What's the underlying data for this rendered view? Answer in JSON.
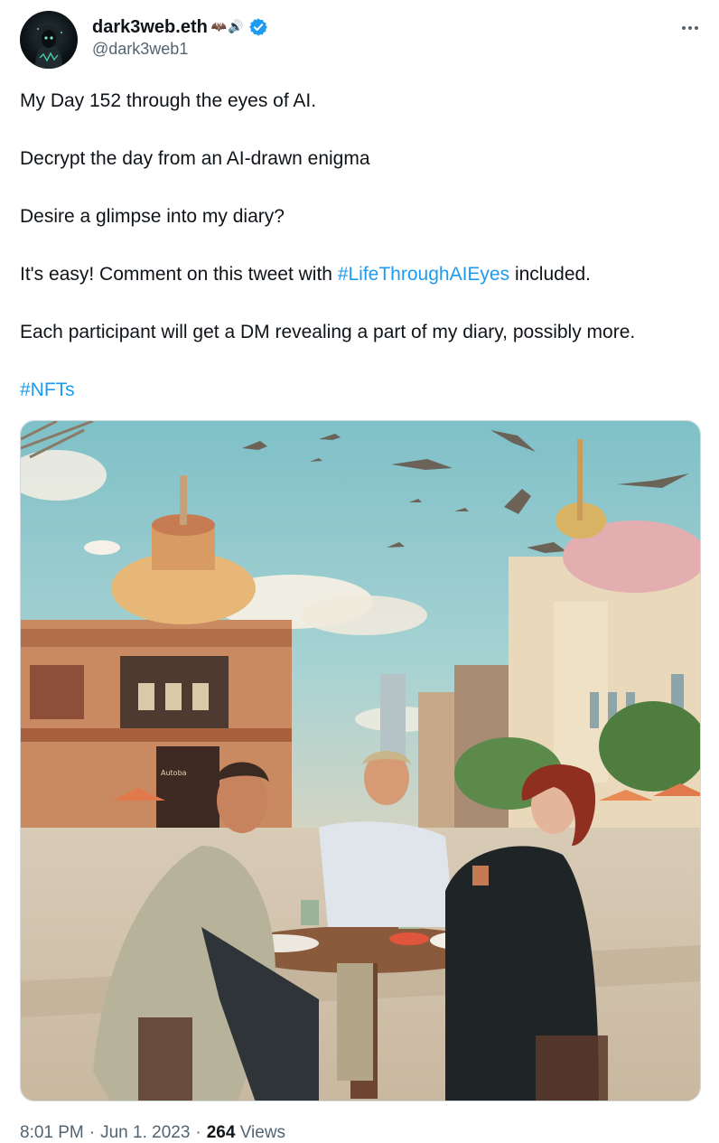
{
  "author": {
    "display_name": "dark3web.eth",
    "name_emoji": "🦇🔊",
    "handle": "@dark3web1",
    "verified_color": "#1d9bf0",
    "avatar_icon": "hooded-figure-avatar"
  },
  "tweet": {
    "line1": "My Day 152 through the eyes of AI.",
    "line2": "Decrypt the day from an AI-drawn enigma",
    "line3": "Desire a glimpse into my diary?",
    "line4_before": "It's easy! Comment on this tweet with ",
    "line4_hashtag": "#LifeThroughAIEyes",
    "line4_after": " included.",
    "line5": "Each participant will get a DM revealing a part of my diary, possibly more.",
    "hashtag2": "#NFTs"
  },
  "media": {
    "description_icon": "ai-cafe-street-scene-image",
    "sign_text": "Autoba"
  },
  "meta": {
    "time": "8:01 PM",
    "date": "Jun 1. 2023",
    "separator": "·",
    "views_count": "264",
    "views_label": "Views"
  },
  "colors": {
    "accent": "#1d9bf0",
    "text": "#0f1419",
    "secondary": "#536471"
  }
}
